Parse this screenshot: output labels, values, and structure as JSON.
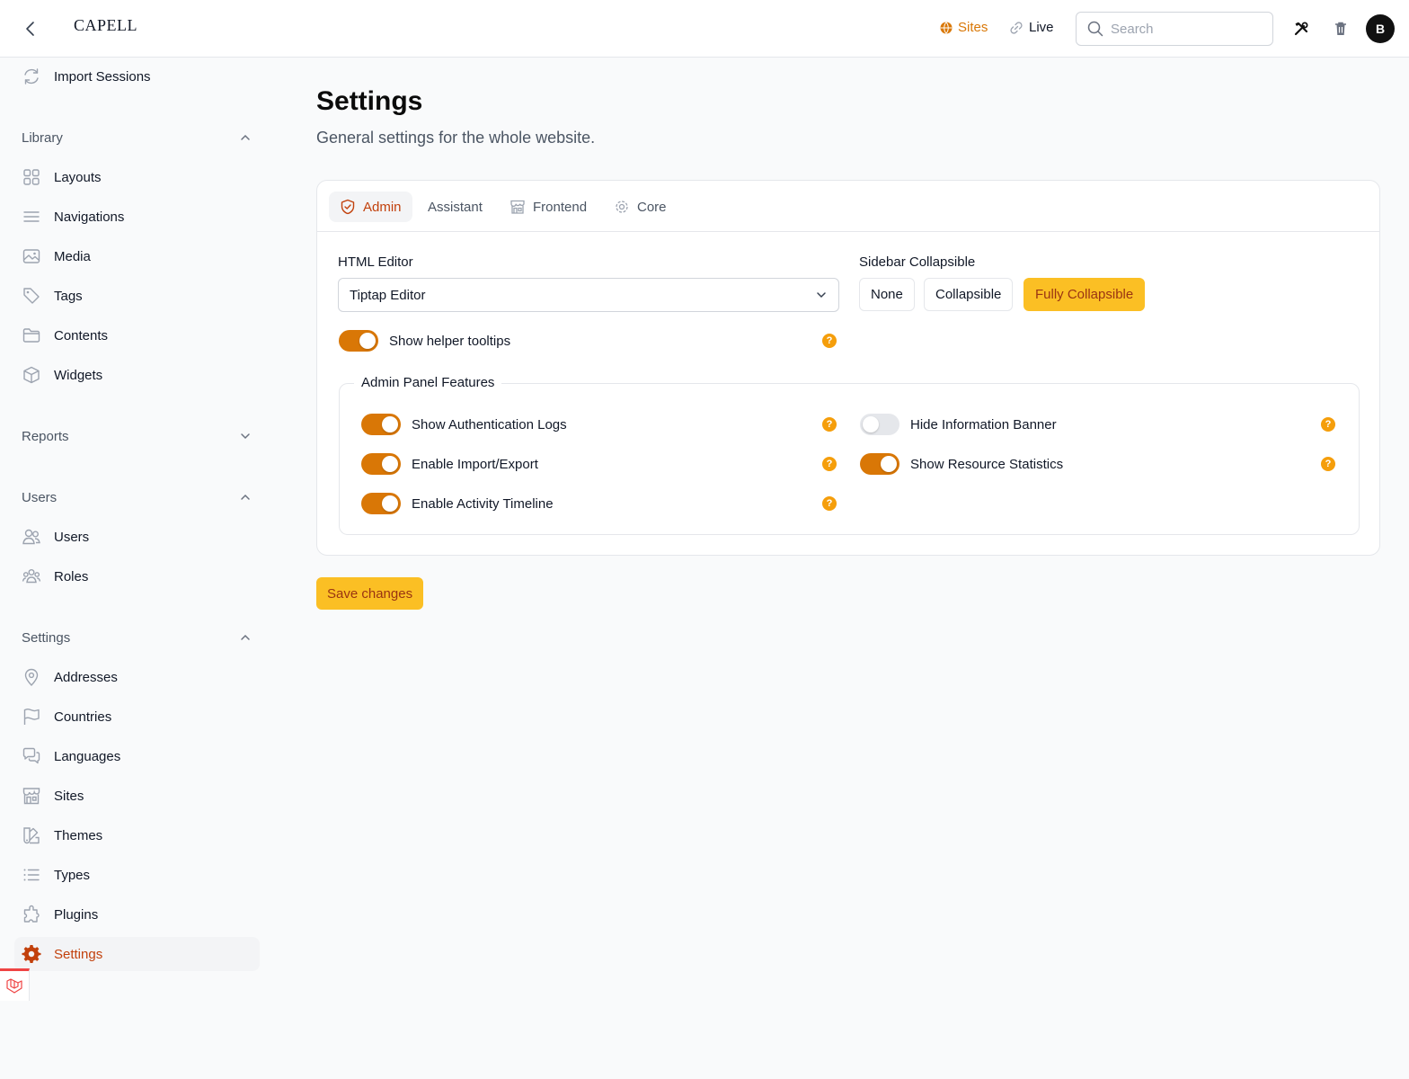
{
  "header": {
    "logo": "CAPELL",
    "sites_label": "Sites",
    "live_label": "Live",
    "search_placeholder": "Search",
    "avatar_initial": "B"
  },
  "sidebar": {
    "top_item": "Import Sessions",
    "groups": {
      "library": {
        "label": "Library",
        "items": [
          "Layouts",
          "Navigations",
          "Media",
          "Tags",
          "Contents",
          "Widgets"
        ]
      },
      "reports": {
        "label": "Reports"
      },
      "users": {
        "label": "Users",
        "items": [
          "Users",
          "Roles"
        ]
      },
      "settings": {
        "label": "Settings",
        "items": [
          "Addresses",
          "Countries",
          "Languages",
          "Sites",
          "Themes",
          "Types",
          "Plugins",
          "Settings"
        ]
      }
    }
  },
  "page": {
    "title": "Settings",
    "subtitle": "General settings for the whole website."
  },
  "tabs": [
    "Admin",
    "Assistant",
    "Frontend",
    "Core"
  ],
  "form": {
    "html_editor_label": "HTML Editor",
    "html_editor_value": "Tiptap Editor",
    "sidebar_label": "Sidebar Collapsible",
    "sidebar_options": [
      "None",
      "Collapsible",
      "Fully Collapsible"
    ],
    "sidebar_selected": "Fully Collapsible",
    "helper_tooltips_label": "Show helper tooltips",
    "helper_tooltips_on": true,
    "features_legend": "Admin Panel Features",
    "features": [
      {
        "label": "Show Authentication Logs",
        "on": true
      },
      {
        "label": "Hide Information Banner",
        "on": false
      },
      {
        "label": "Enable Import/Export",
        "on": true
      },
      {
        "label": "Show Resource Statistics",
        "on": true
      },
      {
        "label": "Enable Activity Timeline",
        "on": true
      }
    ],
    "help_glyph": "?",
    "save_label": "Save changes"
  },
  "colors": {
    "accent": "#d97706",
    "accent_text": "#c2410c",
    "highlight": "#fbbf24",
    "help": "#f59e0b"
  }
}
